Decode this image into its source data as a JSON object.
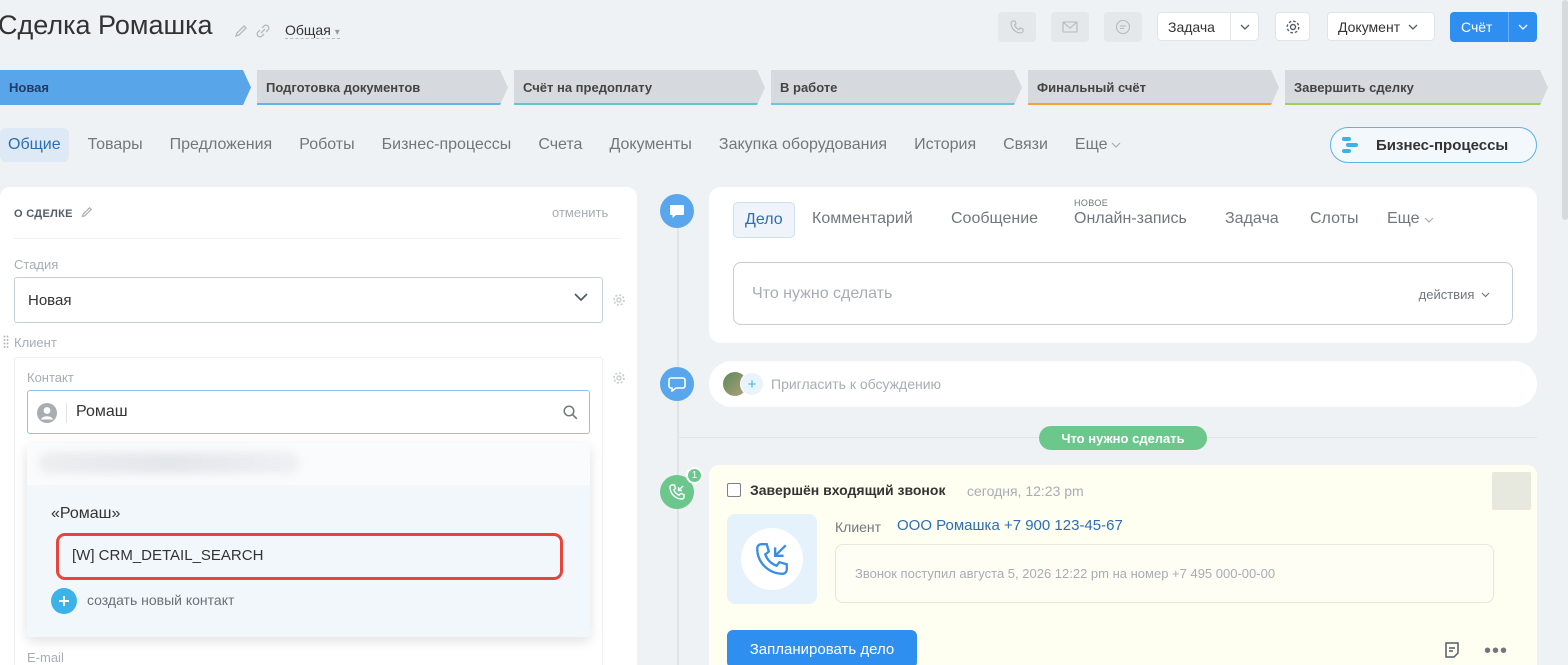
{
  "header": {
    "title": "Сделка Ромашка",
    "category": "Общая",
    "task_label": "Задача",
    "document_label": "Документ",
    "invoice_label": "Счёт"
  },
  "stages": [
    {
      "label": "Новая",
      "bg": "#58a5ea",
      "line": "#58a5ea"
    },
    {
      "label": "Подготовка документов",
      "bg": "#d6dade",
      "line": "#5fb7e8"
    },
    {
      "label": "Счёт на предоплату",
      "bg": "#d6dade",
      "line": "#5fc9c7"
    },
    {
      "label": "В работе",
      "bg": "#d6dade",
      "line": "#67c6e0"
    },
    {
      "label": "Финальный счёт",
      "bg": "#d6dade",
      "line": "#f2a33a"
    },
    {
      "label": "Завершить сделку",
      "bg": "#d6dade",
      "line": "#9ad15a"
    }
  ],
  "tabs": [
    "Общие",
    "Товары",
    "Предложения",
    "Роботы",
    "Бизнес-процессы",
    "Счета",
    "Документы",
    "Закупка оборудования",
    "История",
    "Связи",
    "Еще"
  ],
  "bp_button": "Бизнес-процессы",
  "deal": {
    "section_title": "О СДЕЛКЕ",
    "cancel": "отменить",
    "stage_label": "Стадия",
    "stage_value": "Новая",
    "client_label": "Клиент",
    "contact_label": "Контакт",
    "contact_value": "Ромаш",
    "email_label": "E-mail"
  },
  "dropdown": {
    "query": "«Ромаш»",
    "item": "[W] CRM_DETAIL_SEARCH",
    "create": "создать новый контакт"
  },
  "activity": {
    "tabs": [
      {
        "label": "Дело",
        "x": 0
      },
      {
        "label": "Комментарий"
      },
      {
        "label": "Сообщение"
      },
      {
        "label": "Онлайн-запись"
      },
      {
        "label": "Задача"
      },
      {
        "label": "Слоты"
      },
      {
        "label": "Еще"
      }
    ],
    "new_badge": "НОВОЕ",
    "todo_placeholder": "Что нужно сделать",
    "actions": "действия"
  },
  "invite_text": "Пригласить к обсуждению",
  "todo_pill": "Что нужно сделать",
  "call": {
    "counter": "1",
    "title": "Завершён входящий звонок",
    "time": "сегодня, 12:23 pm",
    "client_label": "Клиент",
    "client_value": "ООО Ромашка +7 900 123-45-67",
    "description": "Звонок поступил августа 5, 2026 12:22 pm на номер +7 495 000-00-00",
    "plan_button": "Запланировать дело"
  }
}
